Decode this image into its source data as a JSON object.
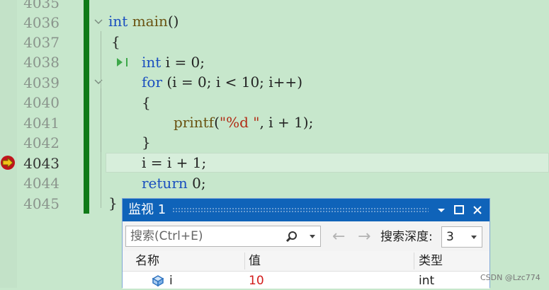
{
  "editor": {
    "lines": [
      {
        "num": "4035"
      },
      {
        "num": "4036"
      },
      {
        "num": "4037"
      },
      {
        "num": "4038"
      },
      {
        "num": "4039"
      },
      {
        "num": "4040"
      },
      {
        "num": "4041"
      },
      {
        "num": "4042"
      },
      {
        "num": "4043"
      },
      {
        "num": "4044"
      },
      {
        "num": "4045"
      }
    ],
    "code": {
      "l4036_kw": "int",
      "l4036_fn": "main",
      "l4036_rest": "()",
      "l4037": "{",
      "l4038_kw": "int",
      "l4038_rest": " i = 0;",
      "l4039_kw": "for",
      "l4039_rest": " (i = 0; i < 10; i++)",
      "l4040": "{",
      "l4041_fn": "printf",
      "l4041_open": "(",
      "l4041_str": "\"%d \"",
      "l4041_rest": ", i + 1);",
      "l4042": "}",
      "l4043": "i = i + 1;",
      "l4044_kw": "return",
      "l4044_rest": " 0;",
      "l4045": "}"
    },
    "current_line": "4043"
  },
  "watch": {
    "title": "监视 1",
    "search_placeholder": "搜索(Ctrl+E)",
    "back_arrow": "←",
    "forward_arrow": "→",
    "depth_label": "搜索深度:",
    "depth_value": "3",
    "columns": {
      "name": "名称",
      "value": "值",
      "type": "类型"
    },
    "rows": [
      {
        "name": "i",
        "value": "10",
        "type": "int"
      }
    ]
  },
  "watermark": "CSDN @Lzc774",
  "colors": {
    "editor_bg": "#c7e7cc",
    "change_bar": "#0f7a17",
    "keyword": "#1a4fbf",
    "string": "#b12b14",
    "watch_title_bg": "#0f63b9",
    "value_changed": "#d21b1b"
  }
}
